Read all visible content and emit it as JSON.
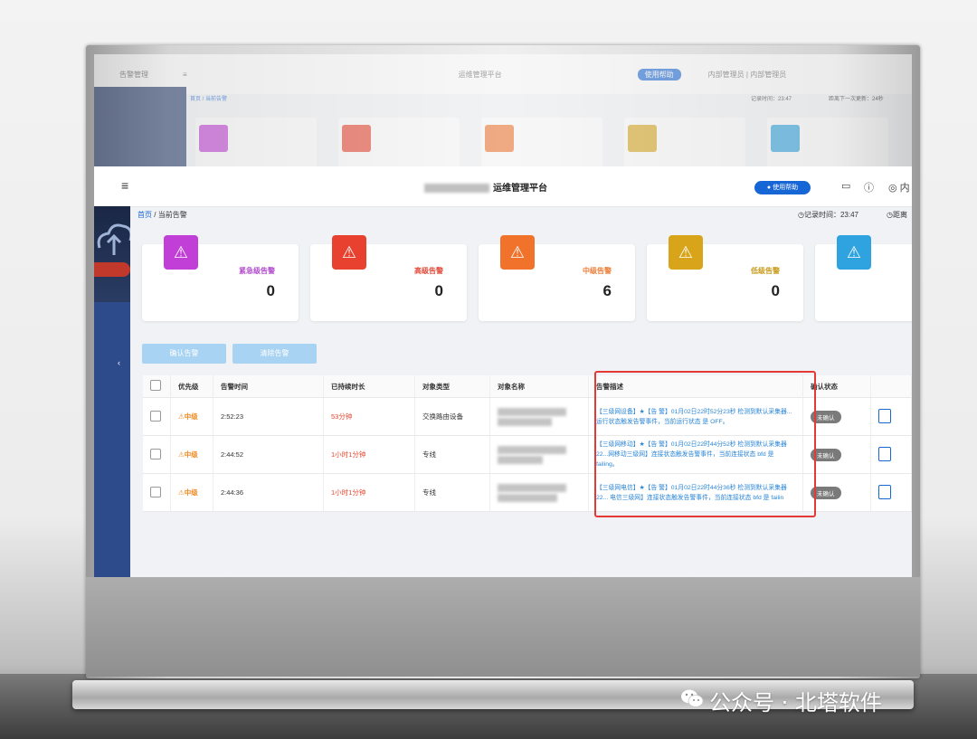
{
  "background_ui": {
    "menu_title": "告警管理",
    "platform": "运维管理平台",
    "help": "使用帮助",
    "breadcrumb": "首页 / 当前告警",
    "record_time": "记录时间：23:47",
    "next_update": "距离下一次更新：24秒",
    "user_notes": "内部管理员 | 内部管理员"
  },
  "header": {
    "platform_title": "运维管理平台",
    "help_button": "使用帮助",
    "user_abbrev": "内"
  },
  "breadcrumb": {
    "home": "首页",
    "separator": "/",
    "current": "当前告警"
  },
  "status": {
    "record_time": "记录时间：23:47",
    "next_update": "距离"
  },
  "cards": [
    {
      "label": "紧急级告警",
      "count": "0",
      "color": "#c13fd6",
      "label_color": "#b44ad0"
    },
    {
      "label": "高级告警",
      "count": "0",
      "color": "#e8412f",
      "label_color": "#e34a3a"
    },
    {
      "label": "中级告警",
      "count": "6",
      "color": "#f0722b",
      "label_color": "#f07d36"
    },
    {
      "label": "低级告警",
      "count": "0",
      "color": "#d8a51a",
      "label_color": "#c99a1a"
    },
    {
      "label": "",
      "count": "",
      "color": "#2ea3e0",
      "label_color": "#2ea3e0"
    }
  ],
  "actions": {
    "confirm": "确认告警",
    "clear": "清除告警"
  },
  "table": {
    "headers": [
      "优先级",
      "告警时间",
      "已持续时长",
      "对象类型",
      "对象名称",
      "告警描述",
      "确认状态"
    ],
    "rows": [
      {
        "priority": "中级",
        "time": "2:52:23",
        "duration": "53分钟",
        "obj_type": "交换路由设备",
        "desc": "【三级网设备】★【告 警】01月02日22时52分23秒 检测到默认采集器... 运行状态触发告警事件，当前运行状态 是 OFF。",
        "status": "未确认"
      },
      {
        "priority": "中级",
        "time": "2:44:52",
        "duration": "1小时1分钟",
        "obj_type": "专线",
        "desc": "【三级网移动】★【告 警】01月02日22时44分52秒 检测到默认采集器22...网移动三级网】连接状态触发告警事件，当前连接状态 bfd 是 failing。",
        "status": "未确认"
      },
      {
        "priority": "中级",
        "time": "2:44:36",
        "duration": "1小时1分钟",
        "obj_type": "专线",
        "desc": "【三级网电信】★【告 警】01月02日22时44分36秒 检测到默认采集器22... 电信三级网】连接状态触发告警事件，当前连接状态 bfd 是 failin",
        "status": "未确认"
      }
    ]
  },
  "watermark": "公众号 · 北塔软件",
  "colors": {
    "accent": "#1766d6",
    "sidebar": "#2d4a8a",
    "highlight_box": "#e53935"
  }
}
